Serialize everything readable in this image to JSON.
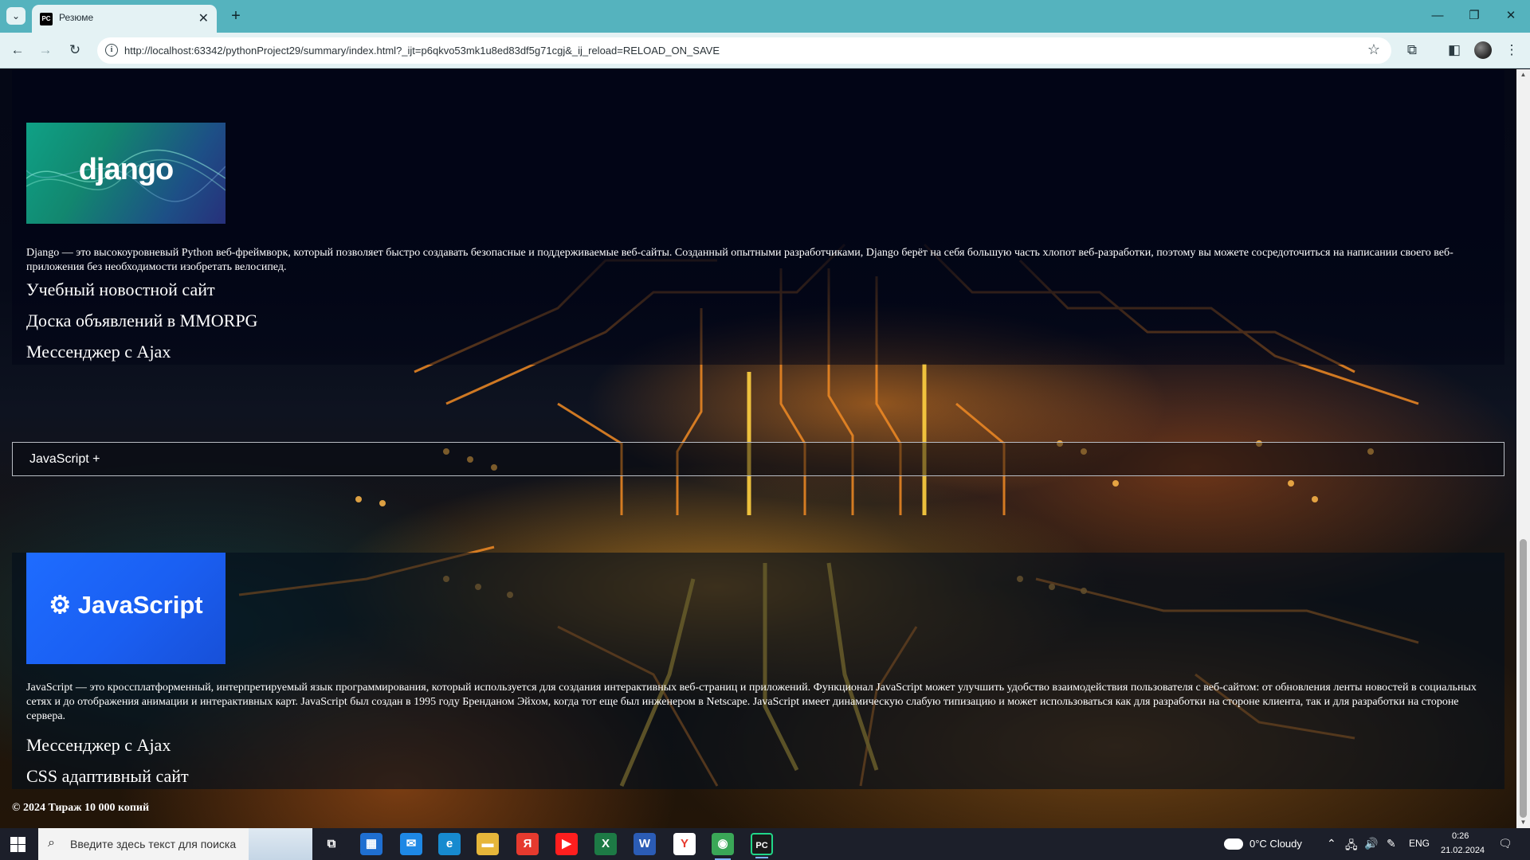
{
  "browser": {
    "tab_title": "Резюме",
    "tab_favicon": "PC",
    "url": "http://localhost:63342/pythonProject29/summary/index.html?_ijt=p6qkvo53mk1u8ed83df5g71cgj&_ij_reload=RELOAD_ON_SAVE"
  },
  "django_section": {
    "logo_text": "django",
    "description": "Django — это высокоуровневый Python веб-фреймворк, который позволяет быстро создавать безопасные и поддерживаемые веб-сайты. Созданный опытными разработчиками, Django берёт на себя большую часть хлопот веб-разработки, поэтому вы можете сосредоточиться на написании своего веб-приложения без необходимости изобретать велосипед.",
    "projects": [
      "Учебный новостной сайт",
      "Доска объявлений в MMORPG",
      "Мессенджер с Ajax"
    ]
  },
  "accordion": {
    "label": "JavaScript +"
  },
  "js_section": {
    "logo_text": "JavaScript",
    "description": "JavaScript — это кроссплатформенный, интерпретируемый язык программирования, который используется для создания интерактивных веб-страниц и приложений. Функционал JavaScript может улучшить удобство взаимодействия пользователя с веб-сайтом: от обновления ленты новостей в социальных сетях и до отображения анимации и интерактивных карт. JavaScript был создан в 1995 году Бренданом Эйхом, когда тот еще был инженером в Netscape. JavaScript имеет динамическую слабую типизацию и может использоваться как для разработки на стороне клиента, так и для разработки на стороне сервера.",
    "projects": [
      "Мессенджер с Ajax",
      "CSS адаптивный сайт"
    ]
  },
  "footer": {
    "text": "© 2024 Тираж 10 000 копий"
  },
  "taskbar": {
    "search_placeholder": "Введите здесь текст для поиска",
    "weather": "0°C  Cloudy",
    "language": "ENG",
    "time": "0:26",
    "date": "21.02.2024",
    "apps": [
      {
        "name": "task-view",
        "glyph": "⧉",
        "color": "#1c1f2a"
      },
      {
        "name": "store",
        "glyph": "▦",
        "color": "#1f6fd1"
      },
      {
        "name": "mail",
        "glyph": "✉",
        "color": "#1e88e5"
      },
      {
        "name": "edge",
        "glyph": "e",
        "color": "#178acf"
      },
      {
        "name": "file-explorer",
        "glyph": "▬",
        "color": "#e6b63a"
      },
      {
        "name": "yandex-browser",
        "glyph": "Я",
        "color": "#e63a2e"
      },
      {
        "name": "youtube",
        "glyph": "▶",
        "color": "#ff1e1e"
      },
      {
        "name": "excel",
        "glyph": "X",
        "color": "#1d7a45"
      },
      {
        "name": "word",
        "glyph": "W",
        "color": "#2b5cb5"
      },
      {
        "name": "yandex",
        "glyph": "Y",
        "color": "#ffffff"
      },
      {
        "name": "chrome",
        "glyph": "◉",
        "color": "#3aa757"
      },
      {
        "name": "pycharm",
        "glyph": "PC",
        "color": "#1a1a1a"
      }
    ]
  }
}
